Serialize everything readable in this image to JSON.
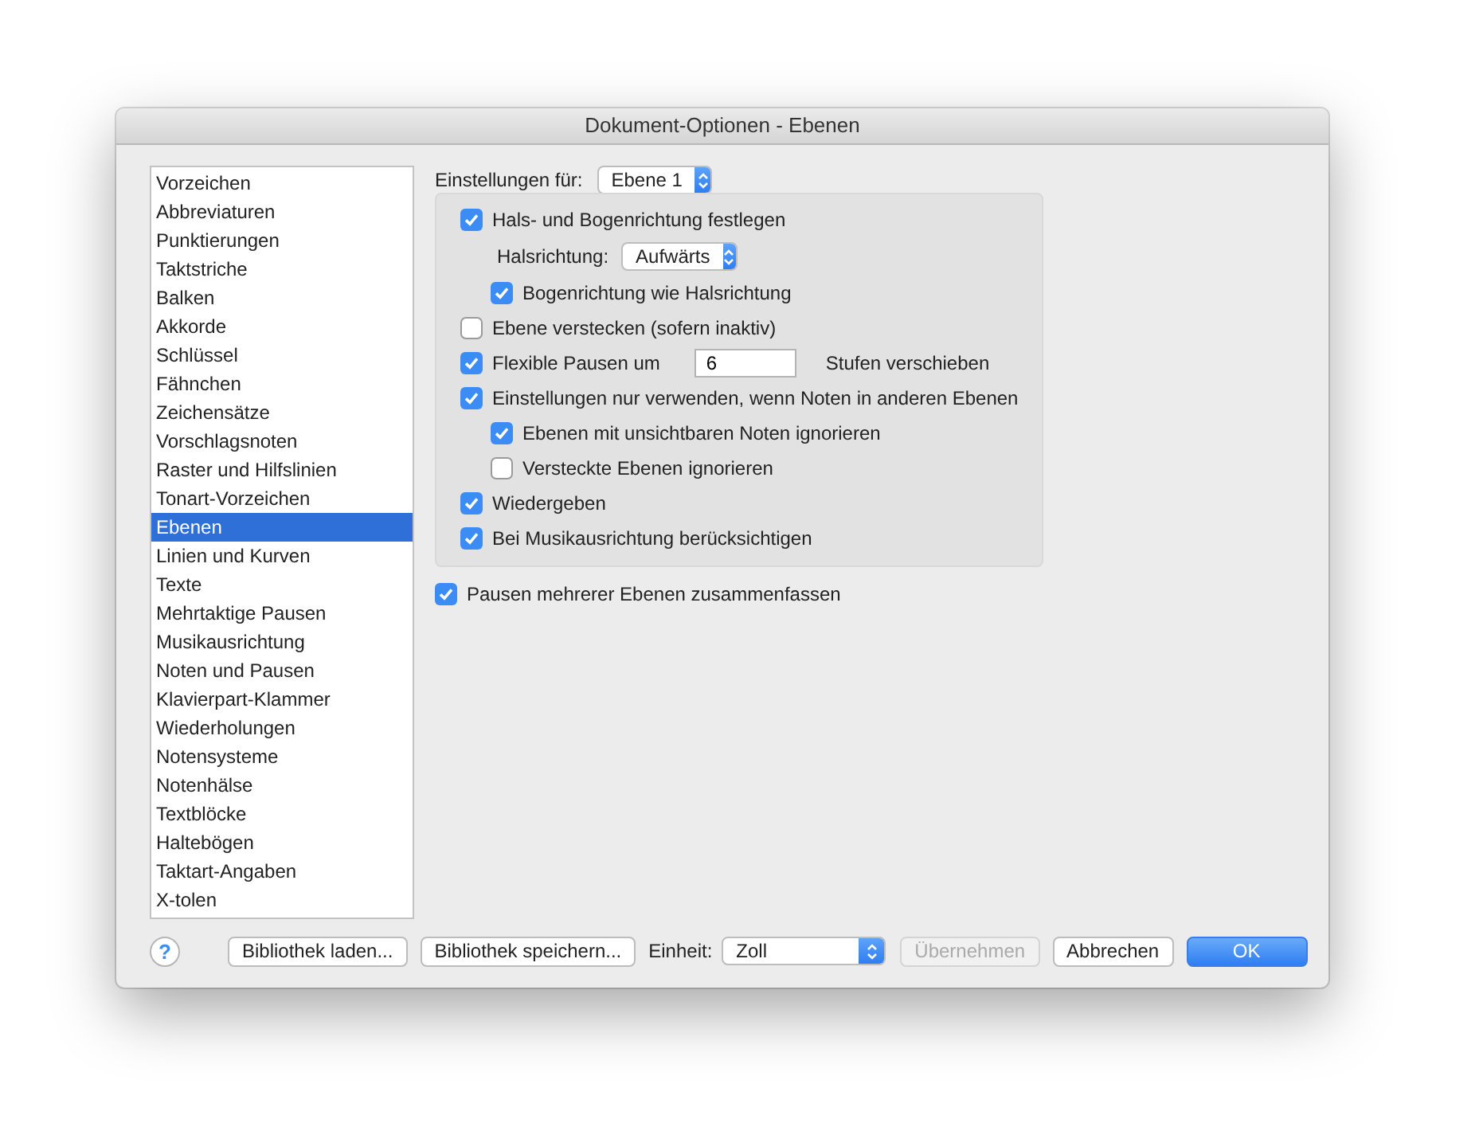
{
  "window": {
    "title": "Dokument-Optionen - Ebenen"
  },
  "sidebar": {
    "items": [
      {
        "label": "Vorzeichen",
        "selected": false
      },
      {
        "label": "Abbreviaturen",
        "selected": false
      },
      {
        "label": "Punktierungen",
        "selected": false
      },
      {
        "label": "Taktstriche",
        "selected": false
      },
      {
        "label": "Balken",
        "selected": false
      },
      {
        "label": "Akkorde",
        "selected": false
      },
      {
        "label": "Schlüssel",
        "selected": false
      },
      {
        "label": "Fähnchen",
        "selected": false
      },
      {
        "label": "Zeichensätze",
        "selected": false
      },
      {
        "label": "Vorschlagsnoten",
        "selected": false
      },
      {
        "label": "Raster und Hilfslinien",
        "selected": false
      },
      {
        "label": "Tonart-Vorzeichen",
        "selected": false
      },
      {
        "label": "Ebenen",
        "selected": true
      },
      {
        "label": "Linien und Kurven",
        "selected": false
      },
      {
        "label": "Texte",
        "selected": false
      },
      {
        "label": "Mehrtaktige Pausen",
        "selected": false
      },
      {
        "label": "Musikausrichtung",
        "selected": false
      },
      {
        "label": "Noten und Pausen",
        "selected": false
      },
      {
        "label": "Klavierpart-Klammer",
        "selected": false
      },
      {
        "label": "Wiederholungen",
        "selected": false
      },
      {
        "label": "Notensysteme",
        "selected": false
      },
      {
        "label": "Notenhälse",
        "selected": false
      },
      {
        "label": "Textblöcke",
        "selected": false
      },
      {
        "label": "Haltebögen",
        "selected": false
      },
      {
        "label": "Taktart-Angaben",
        "selected": false
      },
      {
        "label": "X-tolen",
        "selected": false
      }
    ]
  },
  "settings_for": {
    "label": "Einstellungen für:",
    "value": "Ebene 1"
  },
  "options": [
    {
      "kind": "checkbox",
      "label": "Hals- und Bogenrichtung festlegen",
      "checked": true,
      "children": [
        {
          "kind": "select",
          "label": "Halsrichtung:",
          "value": "Aufwärts"
        },
        {
          "kind": "checkbox",
          "label": "Bogenrichtung wie Halsrichtung",
          "checked": true
        }
      ]
    },
    {
      "kind": "checkbox",
      "label": "Ebene verstecken (sofern inaktiv)",
      "checked": false
    },
    {
      "kind": "number",
      "label": "Flexible Pausen um",
      "checked": true,
      "value": "6",
      "suffix": "Stufen verschieben"
    },
    {
      "kind": "checkbox",
      "label": "Einstellungen nur verwenden, wenn Noten in anderen Ebenen",
      "checked": true,
      "children": [
        {
          "kind": "checkbox",
          "label": "Ebenen mit unsichtbaren Noten ignorieren",
          "checked": true
        },
        {
          "kind": "checkbox",
          "label": "Versteckte Ebenen ignorieren",
          "checked": false
        }
      ]
    },
    {
      "kind": "checkbox",
      "label": "Wiedergeben",
      "checked": true
    },
    {
      "kind": "checkbox",
      "label": "Bei Musikausrichtung berücksichtigen",
      "checked": true
    }
  ],
  "merge_option": {
    "label": "Pausen mehrerer Ebenen zusammenfassen",
    "checked": true
  },
  "footer": {
    "help": "?",
    "buttons": [
      {
        "kind": "button",
        "label": "Bibliothek laden...",
        "disabled": false,
        "primary": false
      },
      {
        "kind": "button",
        "label": "Bibliothek speichern...",
        "disabled": false,
        "primary": false
      },
      {
        "kind": "select",
        "label": "Einheit:",
        "value": "Zoll"
      },
      {
        "kind": "button",
        "label": "Übernehmen",
        "disabled": true,
        "primary": false
      },
      {
        "kind": "button",
        "label": "Abbrechen",
        "disabled": false,
        "primary": false
      },
      {
        "kind": "button",
        "label": "OK",
        "disabled": false,
        "primary": true
      }
    ]
  }
}
